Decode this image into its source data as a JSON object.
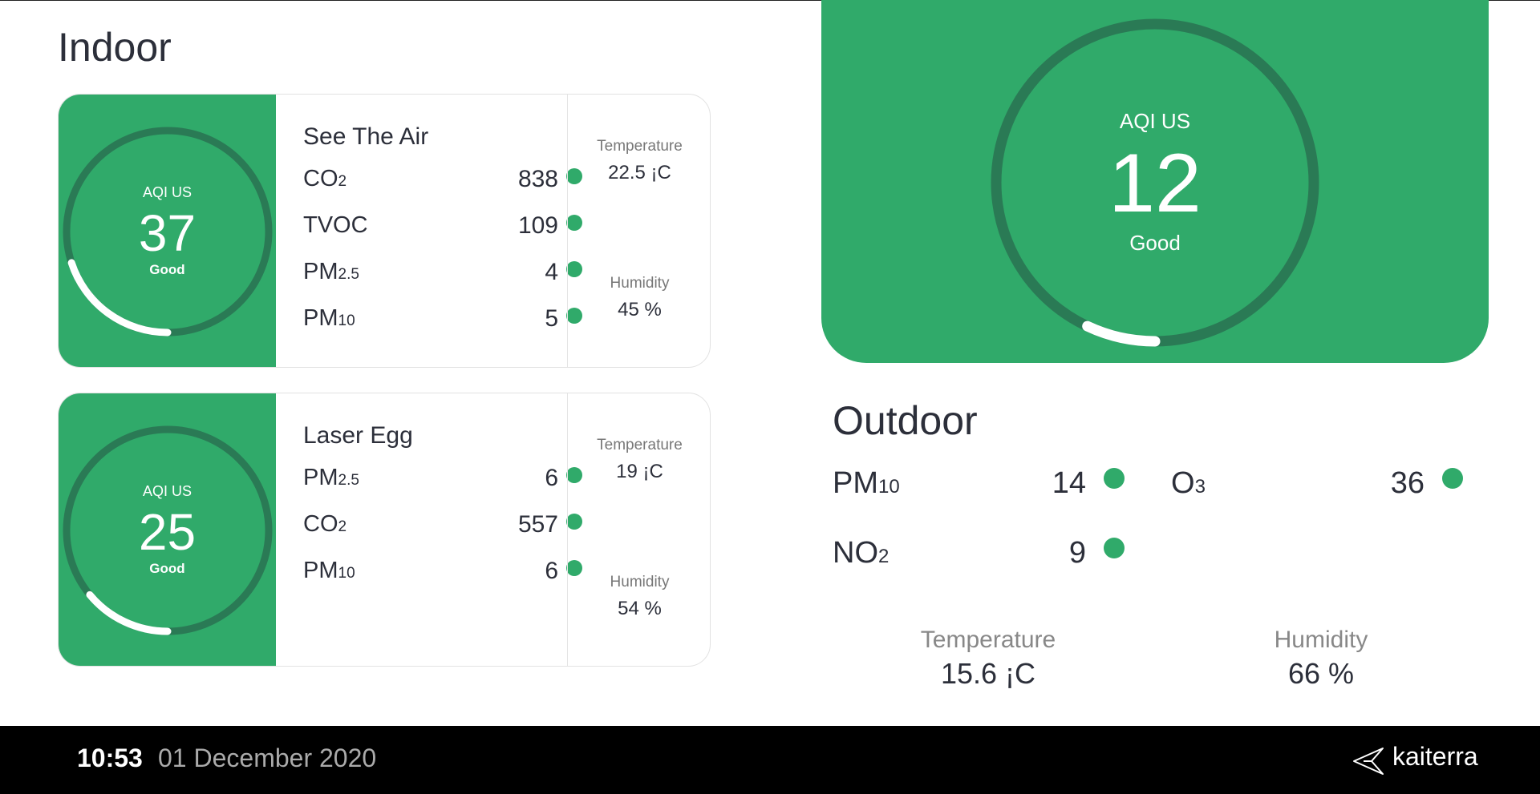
{
  "indoor_title": "Indoor",
  "outdoor_title": "Outdoor",
  "devices": [
    {
      "name": "See The Air",
      "aqi_label": "AQI US",
      "aqi_value": "37",
      "aqi_status": "Good",
      "gauge_fraction": 0.2,
      "metrics": [
        {
          "label": "CO",
          "sub": "2",
          "value": "838"
        },
        {
          "label": "TVOC",
          "sub": "",
          "value": "109"
        },
        {
          "label": "PM",
          "sub": "2.5",
          "value": "4"
        },
        {
          "label": "PM",
          "sub": "10",
          "value": "5"
        }
      ],
      "temperature_label": "Temperature",
      "temperature_value": "22.5 ¡C",
      "humidity_label": "Humidity",
      "humidity_value": "45 %"
    },
    {
      "name": "Laser Egg",
      "aqi_label": "AQI US",
      "aqi_value": "25",
      "aqi_status": "Good",
      "gauge_fraction": 0.14,
      "metrics": [
        {
          "label": "PM",
          "sub": "2.5",
          "value": "6"
        },
        {
          "label": "CO",
          "sub": "2",
          "value": "557"
        },
        {
          "label": "PM",
          "sub": "10",
          "value": "6"
        }
      ],
      "temperature_label": "Temperature",
      "temperature_value": "19 ¡C",
      "humidity_label": "Humidity",
      "humidity_value": "54 %"
    }
  ],
  "outdoor": {
    "aqi_label": "AQI US",
    "aqi_value": "12",
    "aqi_status": "Good",
    "gauge_fraction": 0.07,
    "metrics": [
      {
        "label": "PM",
        "sub": "10",
        "value": "14"
      },
      {
        "label": "O",
        "sub": "3",
        "value": "36"
      },
      {
        "label": "NO",
        "sub": "2",
        "value": "9"
      }
    ],
    "temperature_label": "Temperature",
    "temperature_value": "15.6 ¡C",
    "humidity_label": "Humidity",
    "humidity_value": "66 %"
  },
  "footer": {
    "time": "10:53",
    "date": "01 December 2020",
    "brand": "kaiterra"
  },
  "colors": {
    "green": "#30aa6a",
    "ring_dark": "#2a7a55",
    "text": "#2c2f3a"
  }
}
